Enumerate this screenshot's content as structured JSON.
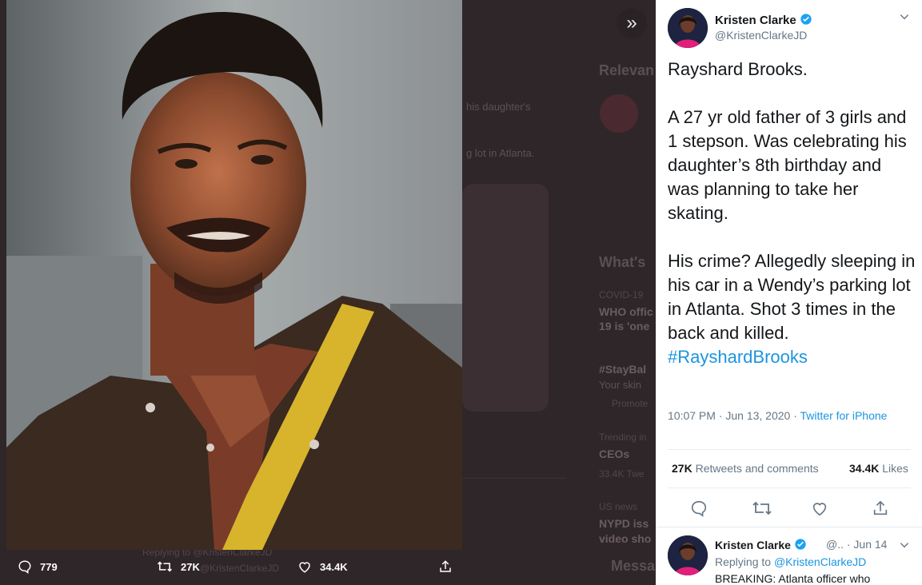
{
  "background": {
    "section_relevant": "Relevan",
    "section_whats": "What's",
    "snippet_1": "his daughter's",
    "snippet_2": "g lot in Atlanta.",
    "trend_1_cat": "COVID-19",
    "trend_1_a": "WHO offic",
    "trend_1_b": "19 is 'one",
    "trend_2_tag": "#StayBal",
    "trend_2_sub": "Your skin",
    "trend_2_promo": "Promote",
    "trend_3_cat": "Trending in",
    "trend_3_title": "CEOs",
    "trend_3_count": "33.4K Twe",
    "trend_4_cat": "US news",
    "trend_4_a": "NYPD iss",
    "trend_4_b": "video sho",
    "messages": "Messa",
    "replying": "Replying to @KristenClarkeJD",
    "replying_handle": "@KristenClarkeJD"
  },
  "photo_actions": {
    "replies": "779",
    "retweets": "27K",
    "likes": "34.4K"
  },
  "tweet": {
    "name": "Kristen Clarke",
    "handle": "@KristenClarkeJD",
    "line_1": "Rayshard Brooks.",
    "line_2": "A 27 yr old father of 3 girls and 1 stepson. Was celebrating his daughter’s 8th birthday and was planning to take her skating.",
    "line_3": "His crime? Allegedly sleeping in his car in a Wendy’s parking lot in Atlanta. Shot 3 times in the back and killed.",
    "hashtag": "#RayshardBrooks",
    "timestamp": "10:07 PM · Jun 13, 2020 · ",
    "source": "Twitter for iPhone",
    "retweets_count": "27K",
    "retweets_label": " Retweets and comments",
    "likes_count": "34.4K",
    "likes_label": " Likes"
  },
  "reply_tweet": {
    "name": "Kristen Clarke",
    "meta": "@.. · Jun 14",
    "replying_prefix": "Replying to ",
    "replying_handle": "@KristenClarkeJD",
    "body": "BREAKING: Atlanta officer who"
  },
  "colors": {
    "accent": "#1b95e0",
    "overlay_bg": "#2f2629"
  }
}
